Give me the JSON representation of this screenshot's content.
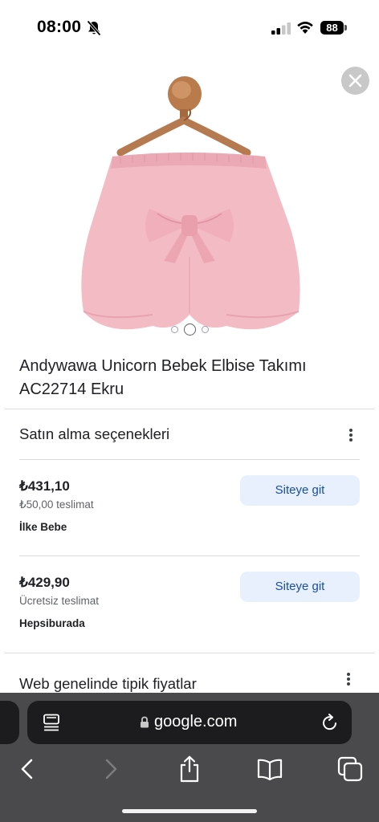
{
  "status_bar": {
    "time": "08:00",
    "battery": "88"
  },
  "product": {
    "title": "Andywawa Unicorn Bebek Elbise Takımı AC22714 Ekru",
    "image_count": 3,
    "active_image": 2
  },
  "purchase_options": {
    "header": "Satın alma seçenekleri",
    "offers": [
      {
        "price": "₺431,10",
        "shipping": "₺50,00 teslimat",
        "seller": "İlke Bebe",
        "button_label": "Siteye git"
      },
      {
        "price": "₺429,90",
        "shipping": "Ücretsiz teslimat",
        "seller": "Hepsiburada",
        "button_label": "Siteye git"
      }
    ]
  },
  "typical_prices": {
    "header": "Web genelinde tipik fiyatlar"
  },
  "browser": {
    "url": "google.com"
  },
  "colors": {
    "accent": "#174ea6",
    "button_bg": "#e8f0fe",
    "toolbar_bg": "#4a4a4c"
  },
  "icons": [
    "bell-slash-icon",
    "signal-icon",
    "wifi-icon",
    "close-icon",
    "more-vert-icon",
    "reader-icon",
    "lock-icon",
    "reload-icon",
    "back-icon",
    "forward-icon",
    "share-icon",
    "bookmarks-icon",
    "tabs-icon"
  ]
}
